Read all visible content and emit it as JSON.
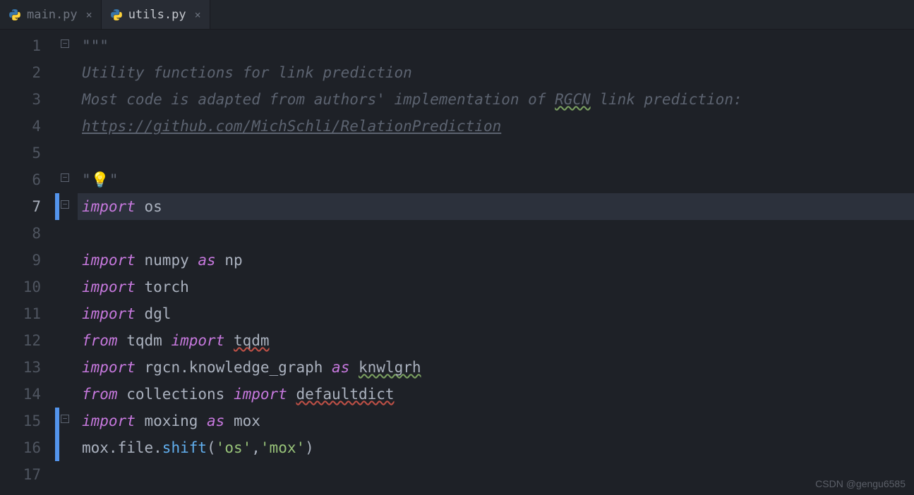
{
  "tabs": [
    {
      "label": "main.py",
      "active": false
    },
    {
      "label": "utils.py",
      "active": true
    }
  ],
  "lines": {
    "l1": "\"\"\"",
    "l2": "Utility functions for link prediction",
    "l3_a": "Most code is adapted from authors' implementation of ",
    "l3_b": "RGCN",
    "l3_c": " link prediction:",
    "l4": "https://github.com/MichSchli/RelationPrediction",
    "l6_q": "\"",
    "kw_import": "import",
    "kw_from": "from",
    "kw_as": "as",
    "id_os": "os",
    "id_numpy": "numpy",
    "id_np": "np",
    "id_torch": "torch",
    "id_dgl": "dgl",
    "id_tqdm": "tqdm",
    "id_rgcn_kg": "rgcn.knowledge_graph",
    "id_knwlgrh": "knwlgrh",
    "id_collections": "collections",
    "id_defaultdict": "defaultdict",
    "id_moxing": "moxing",
    "id_mox": "mox",
    "l16_a": "mox.file.",
    "l16_b": "shift",
    "l16_c": "(",
    "l16_d": "'os'",
    "l16_e": ",",
    "l16_f": "'mox'",
    "l16_g": ")"
  },
  "line_numbers": [
    "1",
    "2",
    "3",
    "4",
    "5",
    "6",
    "7",
    "8",
    "9",
    "10",
    "11",
    "12",
    "13",
    "14",
    "15",
    "16",
    "17"
  ],
  "active_line": 7,
  "watermark": "CSDN @gengu6585"
}
